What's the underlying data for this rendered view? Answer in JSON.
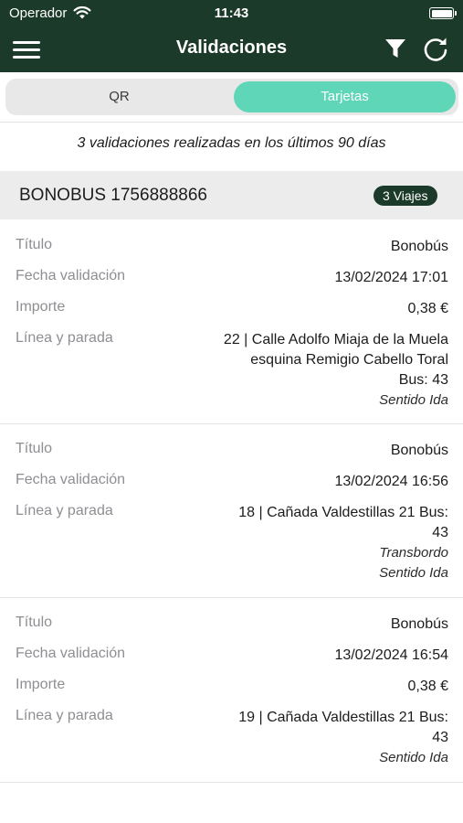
{
  "status_bar": {
    "carrier": "Operador",
    "time": "11:43"
  },
  "navbar": {
    "title": "Validaciones"
  },
  "tabs": [
    {
      "label": "QR",
      "selected": false
    },
    {
      "label": "Tarjetas",
      "selected": true
    }
  ],
  "summary": "3 validaciones realizadas en los últimos 90 días",
  "card": {
    "title": "BONOBUS 1756888866",
    "trips_badge": "3 Viajes"
  },
  "labels": {
    "title": "Título",
    "date": "Fecha validación",
    "amount": "Importe",
    "stop": "Línea y parada"
  },
  "records": [
    {
      "title": "Bonobús",
      "date": "13/02/2024 17:01",
      "amount": "0,38 €",
      "stop_lines": [
        "22 | Calle Adolfo Miaja de la Muela",
        "esquina Remigio Cabello Toral",
        "Bus: 43"
      ],
      "notes": [
        "Sentido Ida"
      ]
    },
    {
      "title": "Bonobús",
      "date": "13/02/2024 16:56",
      "stop_lines": [
        "18 | Cañada Valdestillas 21 Bus:",
        "43"
      ],
      "notes": [
        "Transbordo",
        "Sentido Ida"
      ]
    },
    {
      "title": "Bonobús",
      "date": "13/02/2024 16:54",
      "amount": "0,38 €",
      "stop_lines": [
        "19 | Cañada Valdestillas 21 Bus:",
        "43"
      ],
      "notes": [
        "Sentido Ida"
      ]
    }
  ],
  "colors": {
    "header_bg": "#1c3a2a",
    "accent": "#5fd6b8"
  },
  "icons": {
    "menu": "hamburger-menu-icon",
    "filter": "filter-funnel-icon",
    "refresh": "refresh-icon",
    "wifi": "wifi-icon",
    "battery": "battery-icon"
  }
}
